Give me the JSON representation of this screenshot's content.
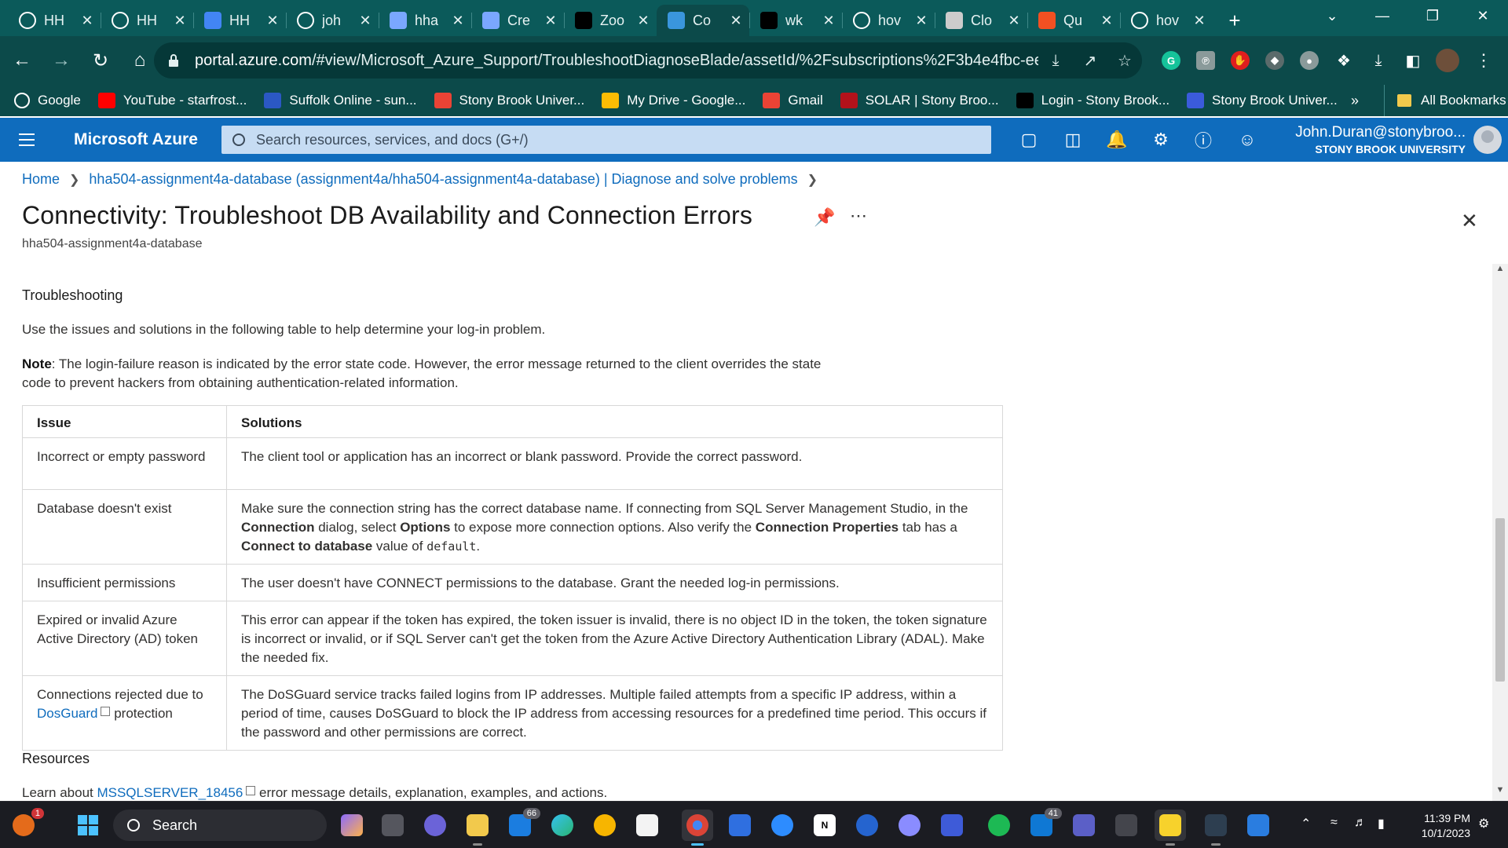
{
  "browser": {
    "tabs": [
      {
        "title": "HH",
        "icon": "github-icon",
        "color": "#ffffff"
      },
      {
        "title": "HH",
        "icon": "github-icon",
        "color": "#ffffff"
      },
      {
        "title": "HH",
        "icon": "docs-icon",
        "color": "#4285f4"
      },
      {
        "title": "joh",
        "icon": "github-icon",
        "color": "#ffffff"
      },
      {
        "title": "hha",
        "icon": "stack-icon",
        "color": "#7aa7ff"
      },
      {
        "title": "Cre",
        "icon": "stack-icon",
        "color": "#7aa7ff"
      },
      {
        "title": "Zoo",
        "icon": "d2l-icon",
        "color": "#000000"
      },
      {
        "title": "Co",
        "icon": "azure-icon",
        "color": "#3a96dd"
      },
      {
        "title": "wk",
        "icon": "d2l-icon",
        "color": "#000000"
      },
      {
        "title": "hov",
        "icon": "google-icon",
        "color": "#ffffff"
      },
      {
        "title": "Clo",
        "icon": "window-icon",
        "color": "#cccccc"
      },
      {
        "title": "Qu",
        "icon": "microsoft-icon",
        "color": "#f25022"
      },
      {
        "title": "hov",
        "icon": "google-icon",
        "color": "#ffffff"
      }
    ],
    "active_tab_index": 7,
    "url_host": "portal.azure.com",
    "url_path": "/#view/Microsoft_Azure_Support/TroubleshootDiagnoseBlade/assetId/%2Fsubscriptions%2F3b4e4fbc-eeed...",
    "bookmarks": [
      {
        "label": "Google",
        "icon": "google-icon",
        "color": "#ffffff"
      },
      {
        "label": "YouTube - starfrost...",
        "icon": "youtube-icon",
        "color": "#ff0000"
      },
      {
        "label": "Suffolk Online - sun...",
        "icon": "suffolk-icon",
        "color": "#2b58c4"
      },
      {
        "label": "Stony Brook Univer...",
        "icon": "gmail-icon",
        "color": "#ea4335"
      },
      {
        "label": "My Drive - Google...",
        "icon": "drive-icon",
        "color": "#fbbc04"
      },
      {
        "label": "Gmail",
        "icon": "gmail-icon",
        "color": "#ea4335"
      },
      {
        "label": "SOLAR | Stony Broo...",
        "icon": "shield-icon",
        "color": "#b3121b"
      },
      {
        "label": "Login - Stony Brook...",
        "icon": "d2l-icon",
        "color": "#000000"
      },
      {
        "label": "Stony Brook Univer...",
        "icon": "calendar-icon",
        "color": "#3b5bdb"
      }
    ],
    "more_bookmarks": "»",
    "all_bookmarks": "All Bookmarks"
  },
  "azure": {
    "brand": "Microsoft Azure",
    "search_placeholder": "Search resources, services, and docs (G+/)",
    "user": "John.Duran@stonybroo...",
    "org": "STONY BROOK UNIVERSITY",
    "accent": "#0f6cbd"
  },
  "breadcrumb": {
    "home": "Home",
    "resource": "hha504-assignment4a-database (assignment4a/hha504-assignment4a-database) | Diagnose and solve problems"
  },
  "page": {
    "title": "Connectivity: Troubleshoot DB Availability and Connection Errors",
    "subtitle": "hha504-assignment4a-database",
    "section_troubleshooting": "Troubleshooting",
    "intro": "Use the issues and solutions in the following table to help determine your log-in problem.",
    "note_label": "Note",
    "note_text": ": The login-failure reason is indicated by the error state code. However, the error message returned to the client overrides the state code to prevent hackers from obtaining authentication-related information.",
    "table_headers": [
      "Issue",
      "Solutions"
    ],
    "rows": {
      "r1_issue": "Incorrect or empty password",
      "r1_solution": "The client tool or application has an incorrect or blank password. Provide the correct password.",
      "r2_issue": "Database doesn't exist",
      "r2_sol_a": "Make sure the connection string has the correct database name. If connecting from SQL Server Management Studio, in the ",
      "r2_sol_b": "Connection",
      "r2_sol_c": " dialog, select ",
      "r2_sol_d": "Options",
      "r2_sol_e": " to expose more connection options. Also verify the ",
      "r2_sol_f": "Connection Properties",
      "r2_sol_g": " tab has a ",
      "r2_sol_h": "Connect to database",
      "r2_sol_i": " value of ",
      "r2_sol_j": "default",
      "r2_sol_k": ".",
      "r3_issue": "Insufficient permissions",
      "r3_solution": "The user doesn't have CONNECT permissions to the database. Grant the needed log-in permissions.",
      "r4_issue": "Expired or invalid Azure Active Directory (AD) token",
      "r4_solution": "This error can appear if the token has expired, the token issuer is invalid, there is no object ID in the token, the token signature is incorrect or invalid, or if SQL Server can't get the token from the Azure Active Directory Authentication Library (ADAL). Make the needed fix.",
      "r5_issue_a": "Connections rejected due to ",
      "r5_issue_link": "DosGuard",
      "r5_issue_b": " protection",
      "r5_solution": "The DoSGuard service tracks failed logins from IP addresses. Multiple failed attempts from a specific IP address, within a period of time, causes DoSGuard to block the IP address from accessing resources for a predefined time period. This occurs if the password and other permissions are correct."
    },
    "section_resources": "Resources",
    "res_prefix": "Learn about ",
    "res_link": "MSSQLSERVER_18456",
    "res_suffix": " error message details, explanation, examples, and actions."
  },
  "taskbar": {
    "search": "Search",
    "mail_badge": "66",
    "teams_badge": "41",
    "time": "11:39 PM",
    "date": "10/1/2023",
    "notif_badge": "1"
  }
}
